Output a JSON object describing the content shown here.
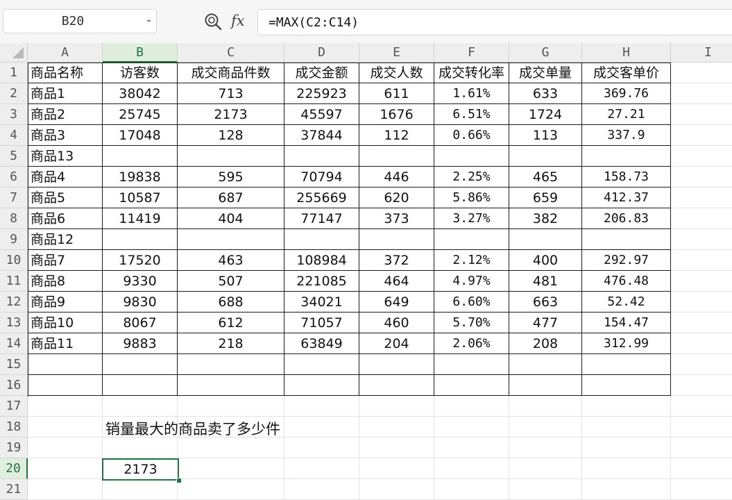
{
  "formula_bar": {
    "name_box": "B20",
    "fx_label": "fx",
    "formula": "=MAX(C2:C14)"
  },
  "columns": [
    "A",
    "B",
    "C",
    "D",
    "E",
    "F",
    "G",
    "H",
    "I"
  ],
  "active": {
    "column": "B",
    "row": "20"
  },
  "rows": [
    {
      "num": "1",
      "cells": [
        "商品名称",
        "访客数",
        "成交商品件数",
        "成交金额",
        "成交人数",
        "成交转化率",
        "成交单量",
        "成交客单价"
      ]
    },
    {
      "num": "2",
      "cells": [
        "商品1",
        "38042",
        "713",
        "225923",
        "611",
        "1.61%",
        "633",
        "369.76"
      ]
    },
    {
      "num": "3",
      "cells": [
        "商品2",
        "25745",
        "2173",
        "45597",
        "1676",
        "6.51%",
        "1724",
        "27.21"
      ]
    },
    {
      "num": "4",
      "cells": [
        "商品3",
        "17048",
        "128",
        "37844",
        "112",
        "0.66%",
        "113",
        "337.9"
      ]
    },
    {
      "num": "5",
      "cells": [
        "商品13",
        "",
        "",
        "",
        "",
        "",
        "",
        ""
      ]
    },
    {
      "num": "6",
      "cells": [
        "商品4",
        "19838",
        "595",
        "70794",
        "446",
        "2.25%",
        "465",
        "158.73"
      ]
    },
    {
      "num": "7",
      "cells": [
        "商品5",
        "10587",
        "687",
        "255669",
        "620",
        "5.86%",
        "659",
        "412.37"
      ]
    },
    {
      "num": "8",
      "cells": [
        "商品6",
        "11419",
        "404",
        "77147",
        "373",
        "3.27%",
        "382",
        "206.83"
      ]
    },
    {
      "num": "9",
      "cells": [
        "商品12",
        "",
        "",
        "",
        "",
        "",
        "",
        ""
      ]
    },
    {
      "num": "10",
      "cells": [
        "商品7",
        "17520",
        "463",
        "108984",
        "372",
        "2.12%",
        "400",
        "292.97"
      ]
    },
    {
      "num": "11",
      "cells": [
        "商品8",
        "9330",
        "507",
        "221085",
        "464",
        "4.97%",
        "481",
        "476.48"
      ]
    },
    {
      "num": "12",
      "cells": [
        "商品9",
        "9830",
        "688",
        "34021",
        "649",
        "6.60%",
        "663",
        "52.42"
      ]
    },
    {
      "num": "13",
      "cells": [
        "商品10",
        "8067",
        "612",
        "71057",
        "460",
        "5.70%",
        "477",
        "154.47"
      ]
    },
    {
      "num": "14",
      "cells": [
        "商品11",
        "9883",
        "218",
        "63849",
        "204",
        "2.06%",
        "208",
        "312.99"
      ]
    },
    {
      "num": "15",
      "cells": [
        "",
        "",
        "",
        "",
        "",
        "",
        "",
        ""
      ]
    },
    {
      "num": "16",
      "cells": [
        "",
        "",
        "",
        "",
        "",
        "",
        "",
        ""
      ]
    },
    {
      "num": "17",
      "cells": []
    },
    {
      "num": "18",
      "cells": []
    },
    {
      "num": "19",
      "cells": []
    },
    {
      "num": "20",
      "cells": []
    },
    {
      "num": "21",
      "cells": []
    }
  ],
  "note": "销量最大的商品卖了多少件",
  "result_value": "2173",
  "colors": {
    "accent": "#217346",
    "header_bg": "#eeeeee",
    "grid_line": "#e2e2e2",
    "table_border": "#1a1a1a"
  }
}
